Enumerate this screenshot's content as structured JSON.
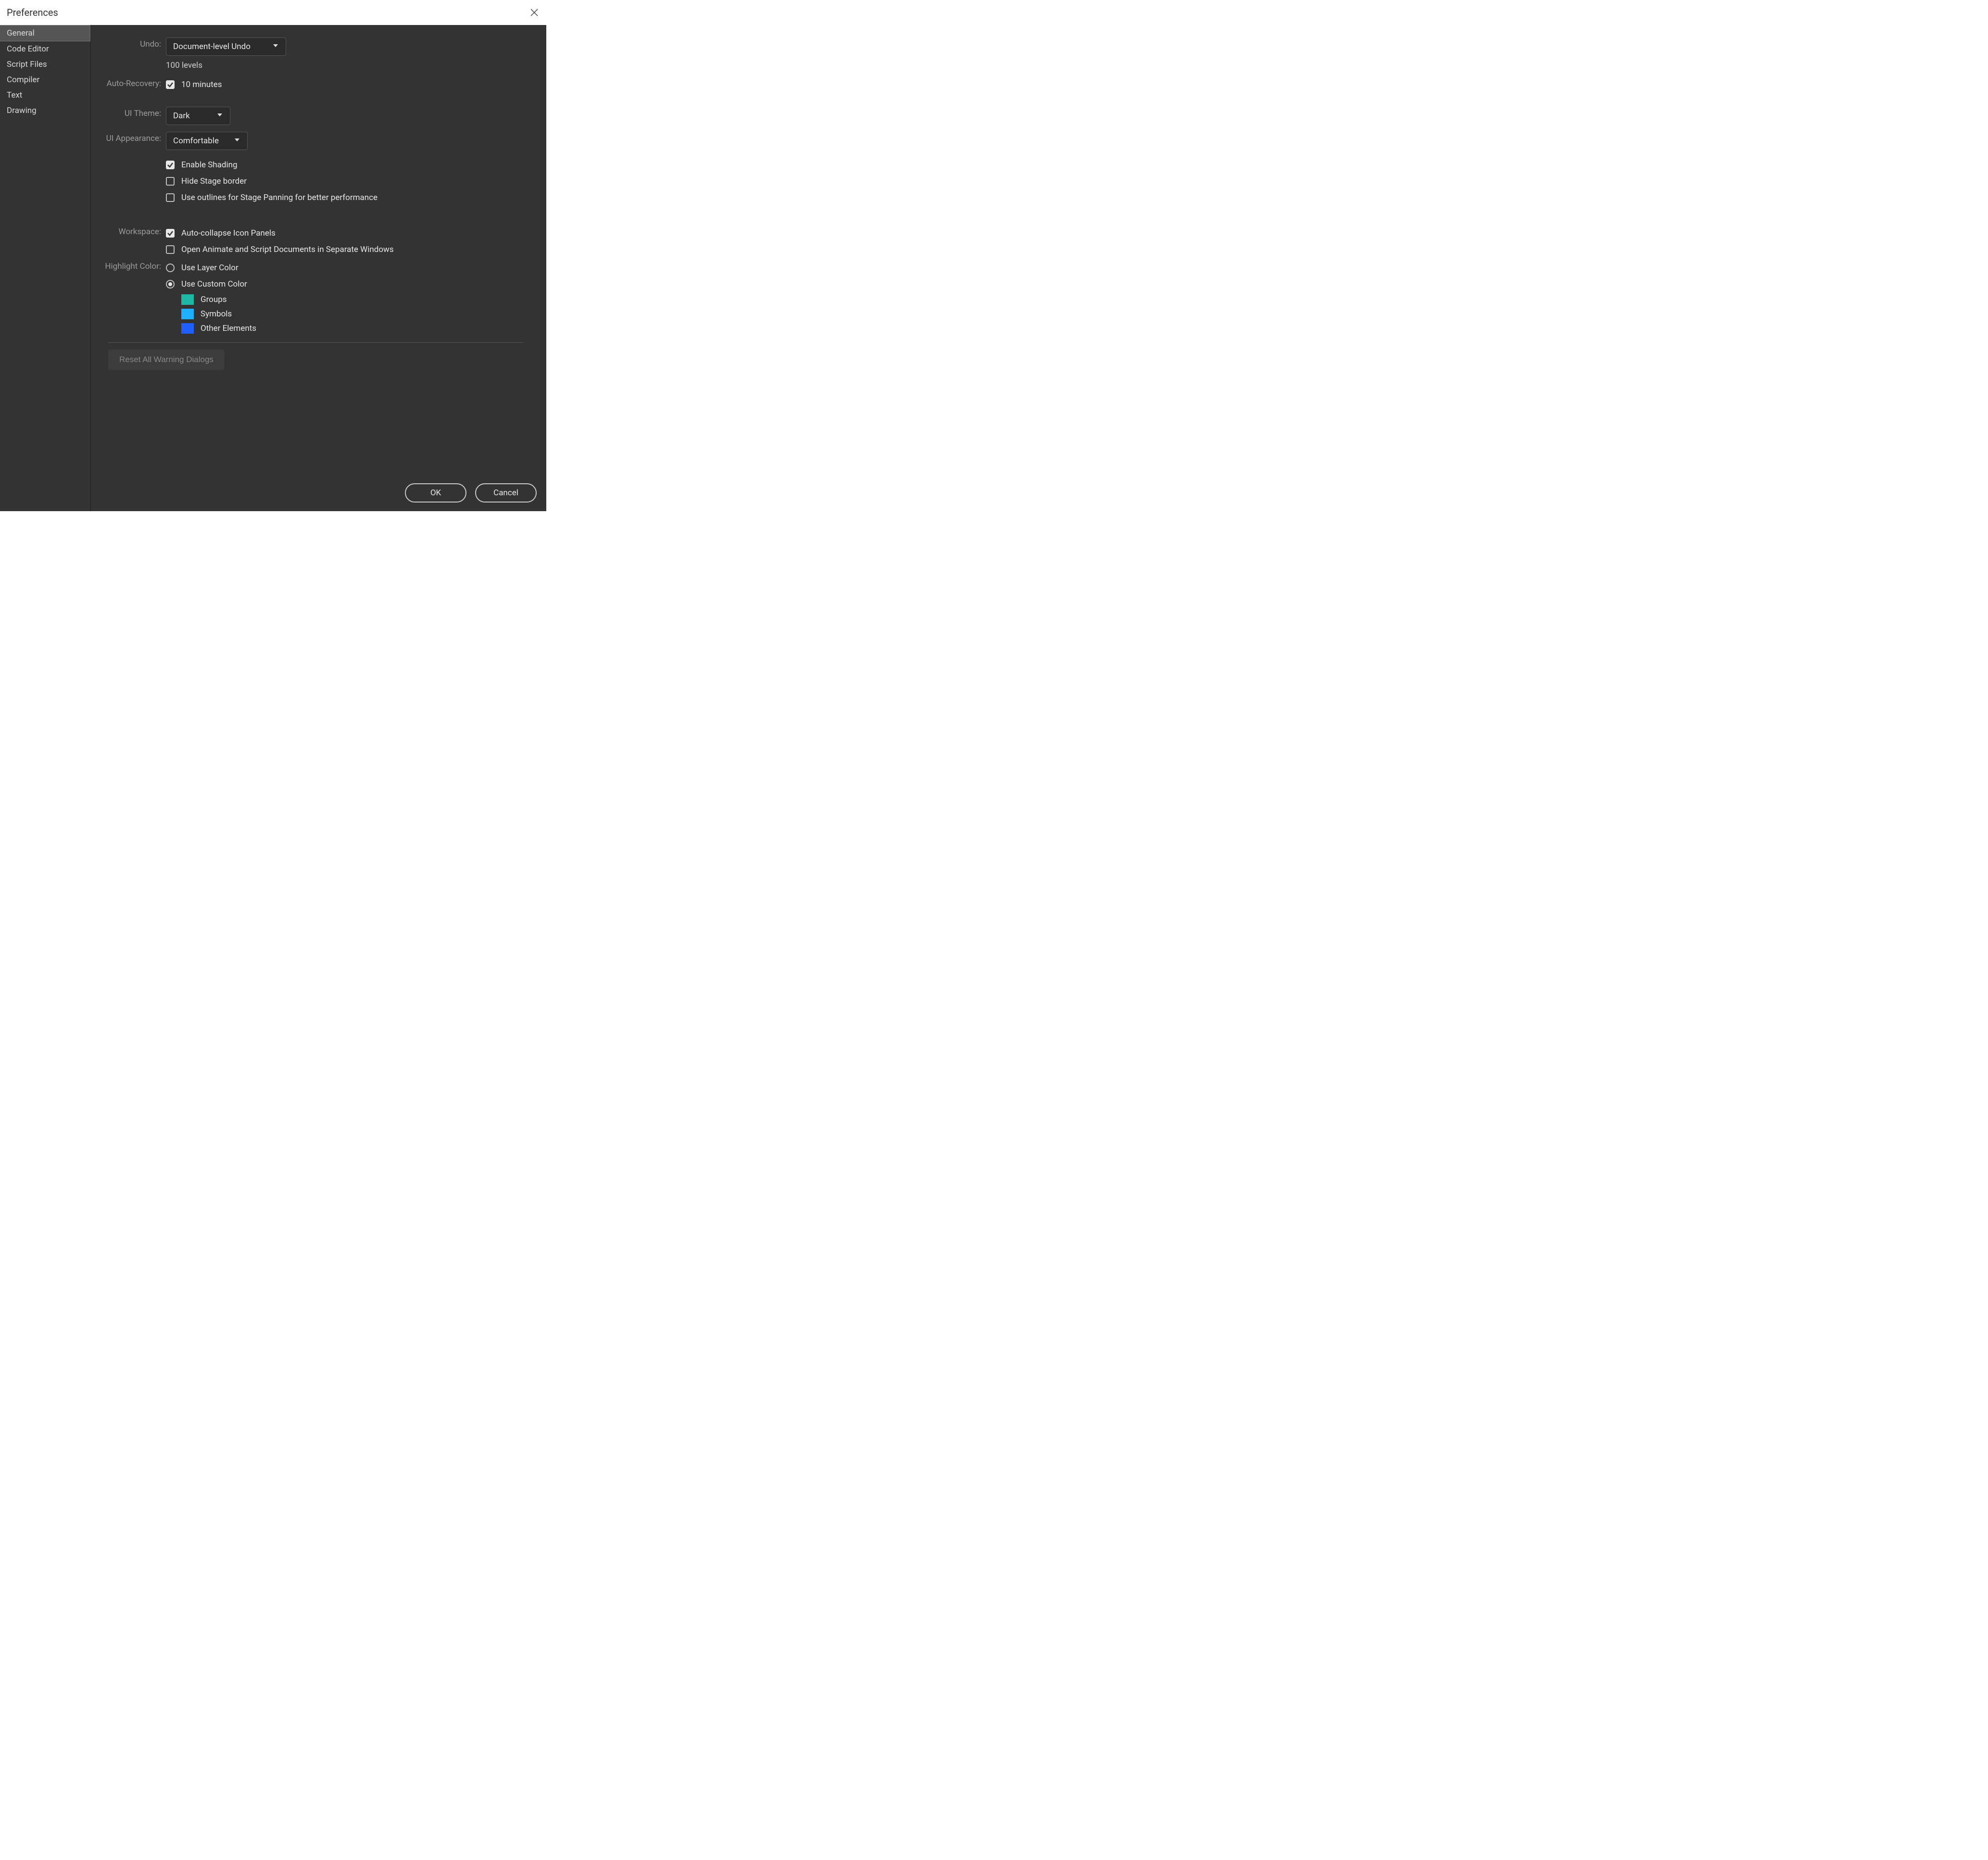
{
  "window": {
    "title": "Preferences"
  },
  "sidebar": {
    "items": [
      {
        "label": "General",
        "selected": true
      },
      {
        "label": "Code Editor",
        "selected": false
      },
      {
        "label": "Script Files",
        "selected": false
      },
      {
        "label": "Compiler",
        "selected": false
      },
      {
        "label": "Text",
        "selected": false
      },
      {
        "label": "Drawing",
        "selected": false
      }
    ]
  },
  "labels": {
    "undo": "Undo:",
    "autoRecovery": "Auto-Recovery:",
    "uiTheme": "UI Theme:",
    "uiAppearance": "UI Appearance:",
    "workspace": "Workspace:",
    "highlightColor": "Highlight Color:"
  },
  "undo": {
    "value": "Document-level Undo",
    "levels_text": "100  levels"
  },
  "autoRecovery": {
    "checked": true,
    "label": "10 minutes"
  },
  "uiTheme": {
    "value": "Dark"
  },
  "uiAppearance": {
    "value": "Comfortable"
  },
  "checkboxes": {
    "enableShading": {
      "label": "Enable Shading",
      "checked": true
    },
    "hideStageBorder": {
      "label": "Hide Stage border",
      "checked": false
    },
    "useOutlines": {
      "label": "Use outlines for Stage Panning for better performance",
      "checked": false
    },
    "autoCollapse": {
      "label": "Auto-collapse Icon Panels",
      "checked": true
    },
    "separateWindows": {
      "label": "Open Animate and Script Documents in Separate Windows",
      "checked": false
    }
  },
  "highlight": {
    "useLayerColor": {
      "label": "Use Layer Color",
      "checked": false
    },
    "useCustomColor": {
      "label": "Use Custom Color",
      "checked": true
    },
    "colors": {
      "groups": {
        "label": "Groups",
        "hex": "#1fb8a5"
      },
      "symbols": {
        "label": "Symbols",
        "hex": "#1fb0ff"
      },
      "other": {
        "label": "Other Elements",
        "hex": "#1f5fff"
      }
    }
  },
  "buttons": {
    "reset": "Reset All Warning Dialogs",
    "ok": "OK",
    "cancel": "Cancel"
  }
}
